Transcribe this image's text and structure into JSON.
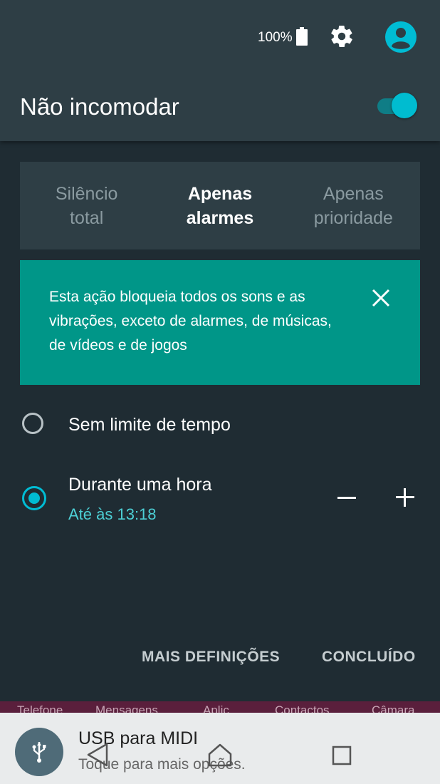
{
  "status_bar": {
    "battery_percent": "100%",
    "icons": [
      "battery-icon",
      "gear-icon",
      "account-icon"
    ]
  },
  "header": {
    "title": "Não incomodar",
    "toggle_on": true
  },
  "modes": [
    {
      "label": "Silêncio\ntotal",
      "selected": false
    },
    {
      "label": "Apenas\nalarmes",
      "selected": true
    },
    {
      "label": "Apenas\nprioridade",
      "selected": false
    }
  ],
  "info": {
    "text": "Esta ação bloqueia todos os sons e as vibrações, exceto de alarmes, de músicas, de vídeos e de jogos"
  },
  "options": {
    "no_limit": {
      "label": "Sem limite de tempo",
      "selected": false
    },
    "one_hour": {
      "label": "Durante uma hora",
      "sublabel": "Até às 13:18",
      "selected": true
    }
  },
  "actions": {
    "more_settings": "MAIS DEFINIÇÕES",
    "done": "CONCLUÍDO"
  },
  "dock": {
    "labels": [
      "Telefone",
      "Mensagens",
      "Aplic.",
      "Contactos",
      "Câmara"
    ]
  },
  "notification": {
    "title": "USB para MIDI",
    "subtitle": "Toque para mais opções."
  },
  "navigation": [
    "back-icon",
    "home-icon",
    "recents-icon"
  ],
  "colors": {
    "accent": "#00bcd4",
    "info_background": "#009688",
    "panel": "#2e3e45",
    "background": "#1f2c33"
  }
}
